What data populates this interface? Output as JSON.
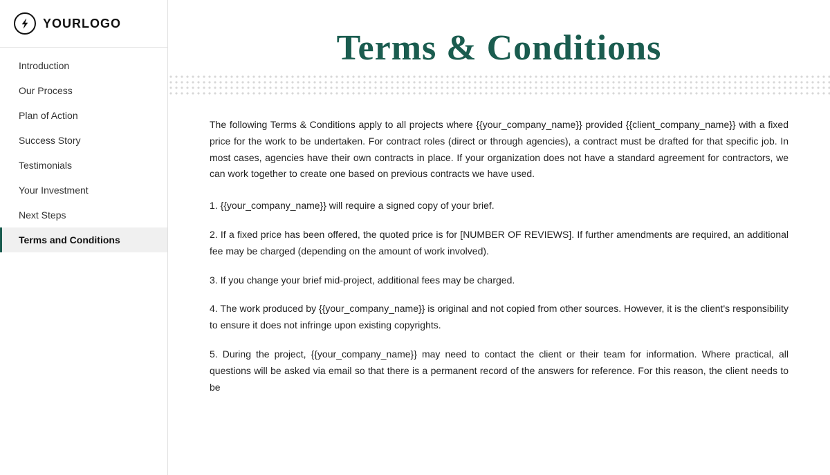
{
  "logo": {
    "text": "YOURLOGO",
    "icon": "bolt"
  },
  "sidebar": {
    "items": [
      {
        "id": "introduction",
        "label": "Introduction",
        "active": false
      },
      {
        "id": "our-process",
        "label": "Our Process",
        "active": false
      },
      {
        "id": "plan-of-action",
        "label": "Plan of Action",
        "active": false
      },
      {
        "id": "success-story",
        "label": "Success Story",
        "active": false
      },
      {
        "id": "testimonials",
        "label": "Testimonials",
        "active": false
      },
      {
        "id": "your-investment",
        "label": "Your Investment",
        "active": false
      },
      {
        "id": "next-steps",
        "label": "Next Steps",
        "active": false
      },
      {
        "id": "terms-and-conditions",
        "label": "Terms and Conditions",
        "active": true
      }
    ]
  },
  "main": {
    "title": "Terms & Conditions",
    "body": {
      "intro_paragraph": "The following Terms & Conditions apply to all projects where {{your_company_name}} provided {{client_company_name}}  with a fixed price for the work to be undertaken. For contract roles (direct or through agencies), a contract must be drafted for that specific job. In most cases, agencies have their own contracts in place. If your organization does not have a standard agreement for contractors, we can work together to create one based on previous contracts we have used.",
      "item1": "1. {{your_company_name}} will require a signed copy of your brief.",
      "item2": "2. If a fixed price has been offered, the quoted price is for [NUMBER OF REVIEWS]. If further amendments are required, an additional fee may be charged (depending on the amount of work involved).",
      "item3": "3. If you change your brief mid-project, additional fees may be charged.",
      "item4": "4. The work produced by {{your_company_name}} is original and not copied from other sources. However, it is the client's responsibility to ensure it does not infringe upon existing copyrights.",
      "item5": "5. During the project, {{your_company_name}} may need to contact the client or their team for information. Where practical, all questions will be asked via email so that there is a permanent record of the answers for reference. For this reason, the client needs to be"
    }
  }
}
